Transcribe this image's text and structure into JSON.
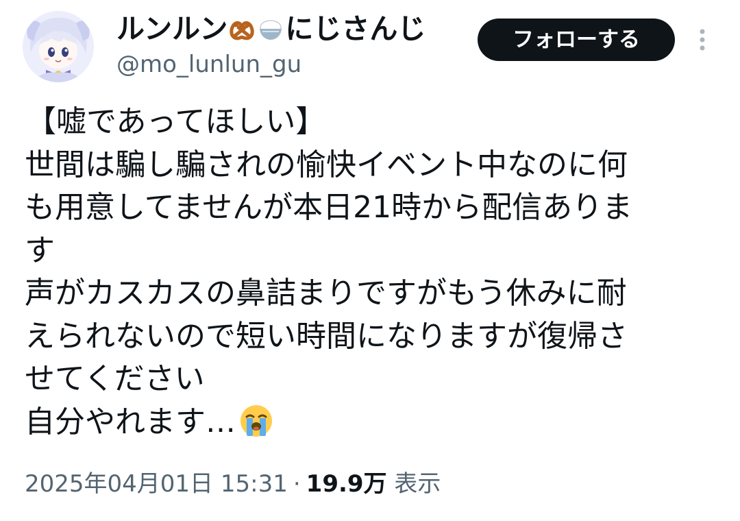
{
  "author": {
    "display_name_part1": "ルンルン",
    "display_name_emoji1": "pretzel-emoji",
    "display_name_emoji2": "rice-bowl-emoji",
    "display_name_part2": "にじさんじ",
    "handle": "@mo_lunlun_gu",
    "avatar_icon": "character-avatar"
  },
  "actions": {
    "follow_label": "フォローする",
    "more_icon": "more-vertical-icon"
  },
  "tweet": {
    "lines": [
      "【嘘であってほしい】",
      "世間は騙し騙されの愉快イベント中なのに何",
      "も用意してませんが本日21時から配信ありま",
      "す",
      "声がカスカスの鼻詰まりですがもう休みに耐",
      "えられないので短い時間になりますが復帰さ",
      "せてください",
      "自分やれます…"
    ],
    "trailing_emoji": "loudly-crying-face-emoji"
  },
  "meta": {
    "timestamp": "2025年04月01日 15:31",
    "separator": "·",
    "views_count": "19.9万",
    "views_label": "表示"
  },
  "colors": {
    "text_primary": "#0f1419",
    "text_secondary": "#536471",
    "button_bg": "#0f1419",
    "button_text": "#ffffff"
  }
}
